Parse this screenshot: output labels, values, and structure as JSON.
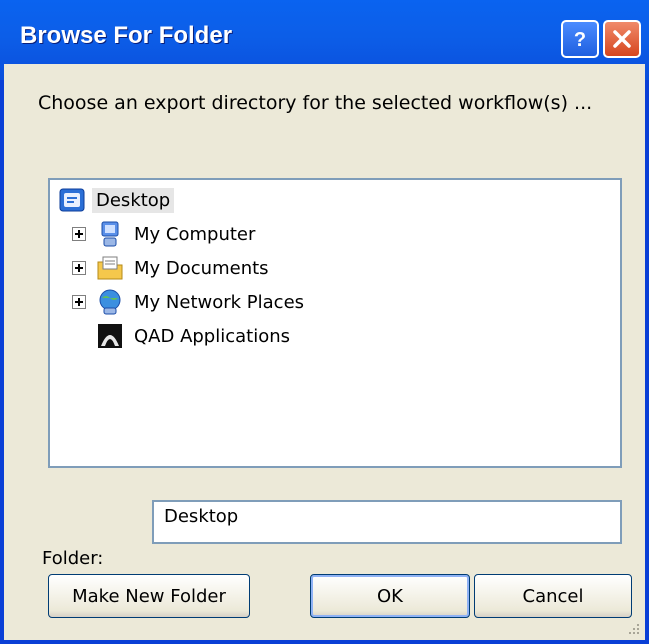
{
  "window": {
    "title": "Browse For Folder",
    "help_icon": "help-icon",
    "close_icon": "close-icon"
  },
  "dialog": {
    "prompt": "Choose an export directory for the selected workflow(s) ..."
  },
  "tree": {
    "items": [
      {
        "label": "Desktop",
        "icon": "desktop-icon",
        "expandable": false,
        "selected": true
      },
      {
        "label": "My Computer",
        "icon": "computer-icon",
        "expandable": true
      },
      {
        "label": "My Documents",
        "icon": "documents-icon",
        "expandable": true
      },
      {
        "label": "My Network Places",
        "icon": "network-icon",
        "expandable": true
      },
      {
        "label": "QAD Applications",
        "icon": "qad-app-icon",
        "expandable": false
      }
    ]
  },
  "folder": {
    "label": "Folder:",
    "value": "Desktop"
  },
  "buttons": {
    "make_new_folder": "Make New Folder",
    "ok": "OK",
    "cancel": "Cancel"
  },
  "colors": {
    "titlebar": "#0a5fe6",
    "dialog_bg": "#ece9d8",
    "close_button": "#d6461e"
  }
}
